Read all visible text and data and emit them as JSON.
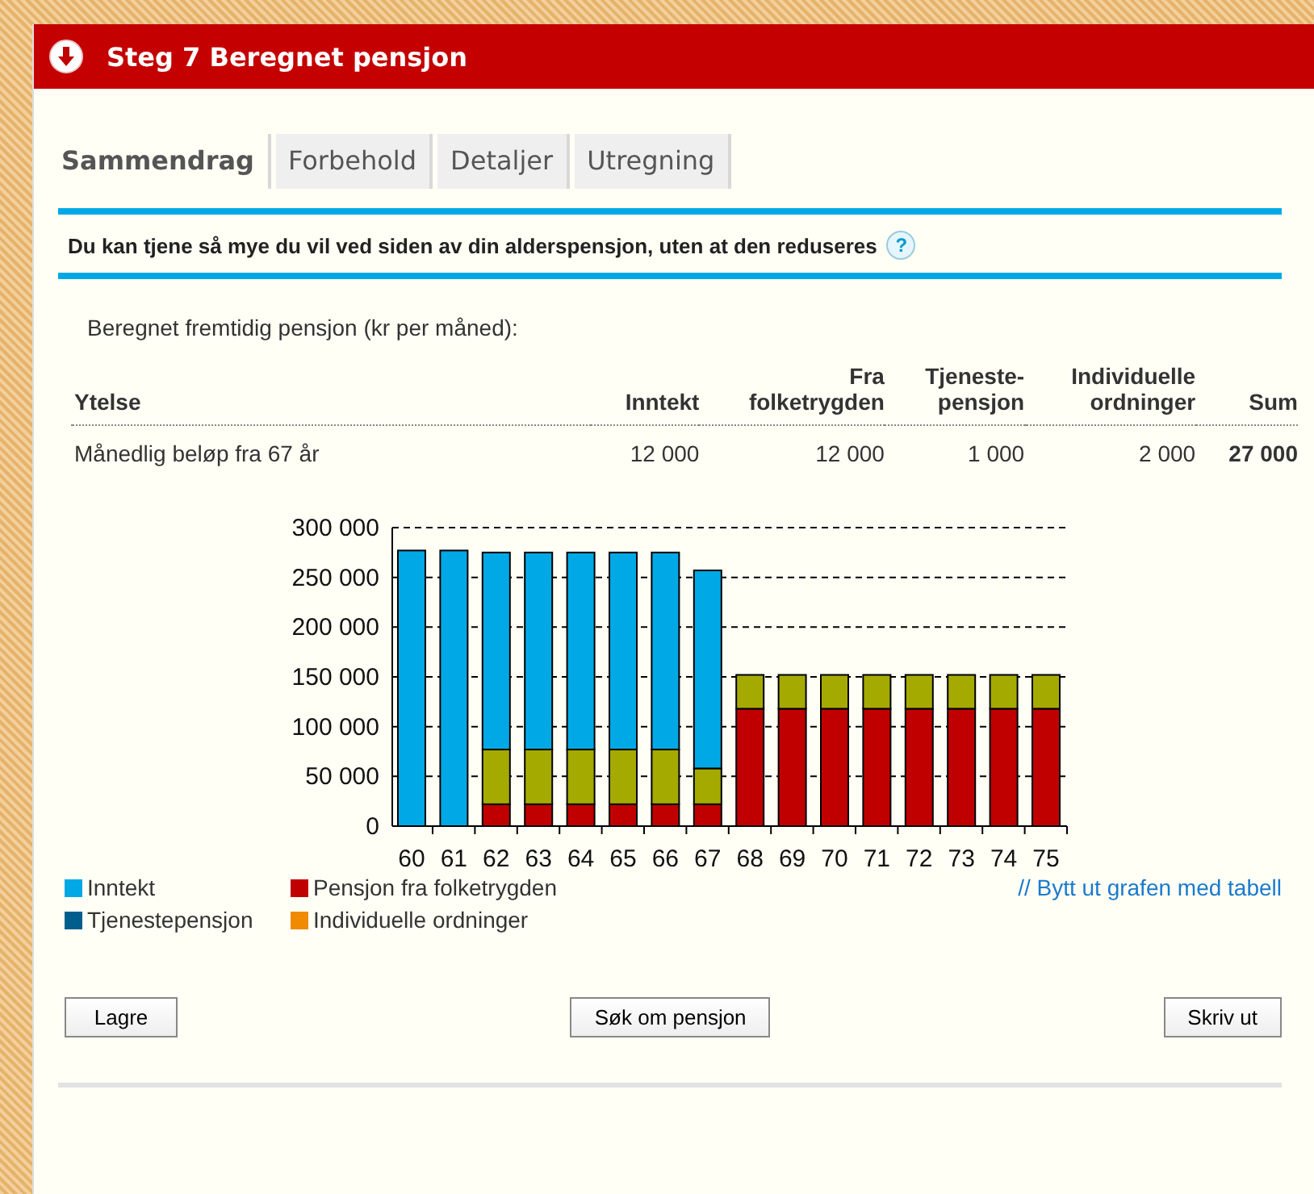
{
  "header": {
    "title": "Steg 7 Beregnet pensjon"
  },
  "tabs": [
    {
      "label": "Sammendrag",
      "selected": true
    },
    {
      "label": "Forbehold",
      "selected": false
    },
    {
      "label": "Detaljer",
      "selected": false
    },
    {
      "label": "Utregning",
      "selected": false
    }
  ],
  "notice": {
    "text": "Du kan tjene så mye du vil ved siden av din alderspensjon, uten at den reduseres",
    "help": "?"
  },
  "intro": "Beregnet fremtidig pensjon (kr per måned):",
  "table": {
    "columns": [
      {
        "lines": [
          "Ytelse"
        ]
      },
      {
        "lines": [
          "Inntekt"
        ]
      },
      {
        "lines": [
          "Fra",
          "folketrygden"
        ]
      },
      {
        "lines": [
          "Tjeneste-",
          "pensjon"
        ]
      },
      {
        "lines": [
          "Individuelle",
          "ordninger"
        ]
      },
      {
        "lines": [
          "Sum"
        ]
      }
    ],
    "rows": [
      [
        "Månedlig beløp fra 67 år",
        "12 000",
        "12 000",
        "1 000",
        "2 000",
        "27 000"
      ]
    ]
  },
  "chart_data": {
    "type": "bar",
    "stacked": true,
    "grid": true,
    "categories": [
      "60",
      "61",
      "62",
      "63",
      "64",
      "65",
      "66",
      "67",
      "68",
      "69",
      "70",
      "71",
      "72",
      "73",
      "74",
      "75"
    ],
    "ylim": [
      0,
      300000
    ],
    "yticks": [
      {
        "value": 0,
        "label": "0"
      },
      {
        "value": 50000,
        "label": "50 000"
      },
      {
        "value": 100000,
        "label": "100 000"
      },
      {
        "value": 150000,
        "label": "150 000"
      },
      {
        "value": 200000,
        "label": "200 000"
      },
      {
        "value": 250000,
        "label": "250 000"
      },
      {
        "value": 300000,
        "label": "300 000"
      }
    ],
    "series": [
      {
        "color": "#c00000",
        "values": [
          null,
          null,
          22000,
          22000,
          22000,
          22000,
          22000,
          22000,
          118000,
          118000,
          118000,
          118000,
          118000,
          118000,
          118000,
          118000
        ]
      },
      {
        "color": "#a5aa00",
        "values": [
          0,
          0,
          55000,
          55000,
          55000,
          55000,
          55000,
          36000,
          34000,
          34000,
          34000,
          34000,
          34000,
          34000,
          34000,
          34000
        ]
      },
      {
        "color": "#00a9e6",
        "values": [
          277000,
          277000,
          198000,
          198000,
          198000,
          198000,
          198000,
          199000,
          0,
          0,
          0,
          0,
          0,
          0,
          0,
          0
        ]
      }
    ]
  },
  "legend": [
    {
      "label": "Inntekt",
      "color": "#00a9e6"
    },
    {
      "label": "Pensjon fra folketrygden",
      "color": "#c00000"
    },
    {
      "label": "Tjenestepensjon",
      "color": "#005e8c"
    },
    {
      "label": "Individuelle ordninger",
      "color": "#f08a00"
    }
  ],
  "swap_link": "// Bytt ut grafen med tabell",
  "buttons": [
    {
      "label": "Lagre"
    },
    {
      "label": "Søk om pensjon"
    },
    {
      "label": "Skriv ut"
    }
  ]
}
